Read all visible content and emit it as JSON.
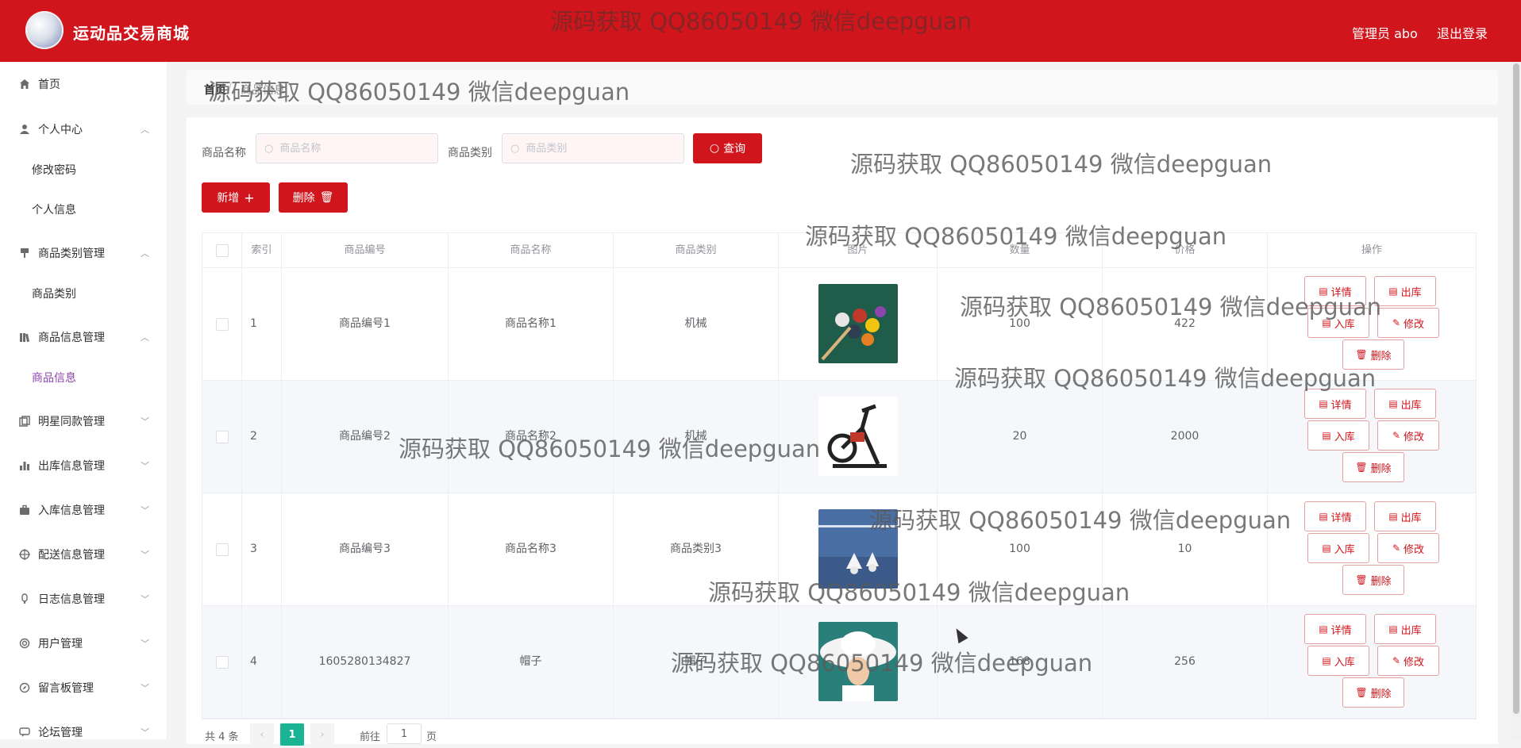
{
  "header": {
    "brand": "运动品交易商城",
    "admin": "管理员 abo",
    "logout": "退出登录"
  },
  "sidebar": {
    "items": [
      {
        "label": "首页",
        "icon": "home-icon"
      },
      {
        "label": "个人中心",
        "icon": "user-icon",
        "sub": [
          "修改密码",
          "个人信息"
        ]
      },
      {
        "label": "商品类别管理",
        "icon": "brush-icon",
        "sub": [
          "商品类别"
        ]
      },
      {
        "label": "商品信息管理",
        "icon": "book-icon",
        "sub": [
          "商品信息"
        ]
      },
      {
        "label": "明星同款管理",
        "icon": "copy-icon"
      },
      {
        "label": "出库信息管理",
        "icon": "bar-chart-icon"
      },
      {
        "label": "入库信息管理",
        "icon": "briefcase-icon"
      },
      {
        "label": "配送信息管理",
        "icon": "crosshair-icon"
      },
      {
        "label": "日志信息管理",
        "icon": "key-icon"
      },
      {
        "label": "用户管理",
        "icon": "circle-dot-icon"
      },
      {
        "label": "留言板管理",
        "icon": "compass-icon"
      },
      {
        "label": "论坛管理",
        "icon": "forum-icon"
      }
    ],
    "active_sub": "商品信息"
  },
  "breadcrumb": {
    "first": "首页",
    "second": "商品信息"
  },
  "search": {
    "name_label": "商品名称",
    "name_placeholder": "商品名称",
    "cat_label": "商品类别",
    "cat_placeholder": "商品类别",
    "query_button": "查询"
  },
  "actions": {
    "add": "新增",
    "delete": "删除"
  },
  "table": {
    "columns": [
      "",
      "索引",
      "商品编号",
      "商品名称",
      "商品类别",
      "图片",
      "数量",
      "价格",
      "操作"
    ],
    "rows": [
      {
        "index": "1",
        "code": "商品编号1",
        "name": "商品名称1",
        "category": "机械",
        "qty": "100",
        "price": "422",
        "image": "billiards"
      },
      {
        "index": "2",
        "code": "商品编号2",
        "name": "商品名称2",
        "category": "机械",
        "qty": "20",
        "price": "2000",
        "image": "exercise-bike"
      },
      {
        "index": "3",
        "code": "商品编号3",
        "name": "商品名称3",
        "category": "商品类别3",
        "qty": "100",
        "price": "10",
        "image": "badminton"
      },
      {
        "index": "4",
        "code": "1605280134827",
        "name": "帽子",
        "category": "帽子",
        "qty": "168",
        "price": "256",
        "image": "hat"
      }
    ],
    "ops": {
      "detail": "详情",
      "out": "出库",
      "in": "入库",
      "edit": "修改",
      "delete": "删除"
    }
  },
  "pagination": {
    "total": "共 4 条",
    "page": "1",
    "goto": "前往",
    "goto_value": "1",
    "unit": "页"
  },
  "watermark": "源码获取 QQ86050149 微信deepguan",
  "colors": {
    "primary": "#d0151c",
    "active_submenu": "#8e44ad",
    "pager_active": "#1ab394"
  }
}
